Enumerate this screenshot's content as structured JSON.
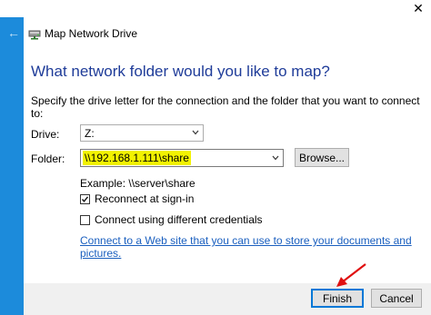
{
  "window": {
    "close_glyph": "✕",
    "back_glyph": "←",
    "title": "Map Network Drive"
  },
  "main": {
    "heading": "What network folder would you like to map?",
    "description": "Specify the drive letter for the connection and the folder that you want to connect to:",
    "drive_label": "Drive:",
    "drive_value": "Z:",
    "folder_label": "Folder:",
    "folder_value": "\\\\192.168.1.111\\share",
    "browse_label": "Browse...",
    "example": "Example: \\\\server\\share",
    "reconnect_label": "Reconnect at sign-in",
    "reconnect_checked": true,
    "credentials_label": "Connect using different credentials",
    "credentials_checked": false,
    "link_text": "Connect to a Web site that you can use to store your documents and pictures."
  },
  "footer": {
    "finish_label": "Finish",
    "cancel_label": "Cancel"
  },
  "colors": {
    "accent_blue": "#1c8bdb",
    "heading_blue": "#1f3c99",
    "link_blue": "#1a5fbf",
    "highlight_yellow": "#f2f200",
    "annotation_red": "#e01010"
  },
  "icons": [
    "close-icon",
    "back-arrow-icon",
    "network-drive-icon",
    "chevron-down-icon",
    "checkmark-icon",
    "annotation-arrow-icon"
  ]
}
